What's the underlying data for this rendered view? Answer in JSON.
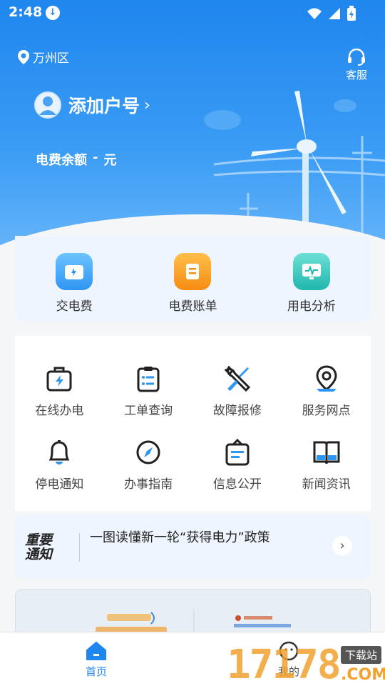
{
  "status_bar": {
    "time": "2:48"
  },
  "header": {
    "location": "万州区",
    "service_label": "客服",
    "account_label": "添加户号",
    "balance_label": "电费余额",
    "balance_value": "-",
    "balance_unit": "元"
  },
  "quick_actions": [
    {
      "label": "交电费",
      "icon": "wallet-bolt-icon",
      "color": "#3aa8f7"
    },
    {
      "label": "电费账单",
      "icon": "bill-icon",
      "color": "#f7a21b"
    },
    {
      "label": "用电分析",
      "icon": "monitor-chart-icon",
      "color": "#2fc6bd"
    }
  ],
  "services": [
    {
      "label": "在线办电",
      "icon": "briefcase-bolt-icon"
    },
    {
      "label": "工单查询",
      "icon": "clipboard-list-icon"
    },
    {
      "label": "故障报修",
      "icon": "wrench-screwdriver-icon"
    },
    {
      "label": "服务网点",
      "icon": "map-pin-icon"
    },
    {
      "label": "停电通知",
      "icon": "bell-icon"
    },
    {
      "label": "办事指南",
      "icon": "compass-icon"
    },
    {
      "label": "信息公开",
      "icon": "notice-board-icon"
    },
    {
      "label": "新闻资讯",
      "icon": "open-book-icon"
    }
  ],
  "notice": {
    "badge_line1": "重要",
    "badge_line2": "通知",
    "text": "一图读懂新一轮“获得电力”政策"
  },
  "tabbar": {
    "home_label": "首页",
    "mine_label": "我的"
  },
  "watermark": {
    "number": "17178",
    "sub": "下载站",
    "com": ".COM"
  },
  "colors": {
    "primary": "#1f86ee"
  }
}
